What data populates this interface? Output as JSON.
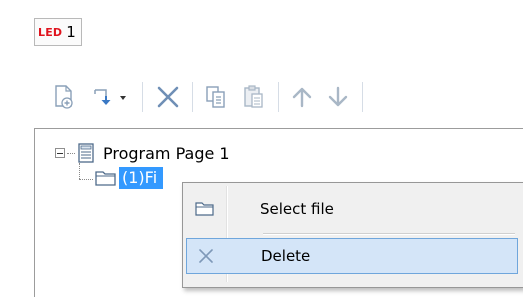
{
  "led": {
    "tag": "LED",
    "value": "1",
    "tag_color": "#e0141e"
  },
  "toolbar": {
    "buttons": [
      {
        "icon": "new-page-icon"
      },
      {
        "icon": "insert-dropdown-icon"
      },
      {
        "icon": "delete-x-icon"
      },
      {
        "icon": "copy-icon"
      },
      {
        "icon": "paste-icon"
      },
      {
        "icon": "move-up-icon"
      },
      {
        "icon": "move-down-icon"
      }
    ]
  },
  "tree": {
    "root_label": "Program Page 1",
    "child_label": "(1)Fi",
    "selection_color": "#3399ff"
  },
  "context_menu": {
    "items": [
      {
        "label": "Select file",
        "icon": "folder-icon"
      },
      {
        "label": "Delete",
        "icon": "delete-x-icon"
      }
    ]
  }
}
